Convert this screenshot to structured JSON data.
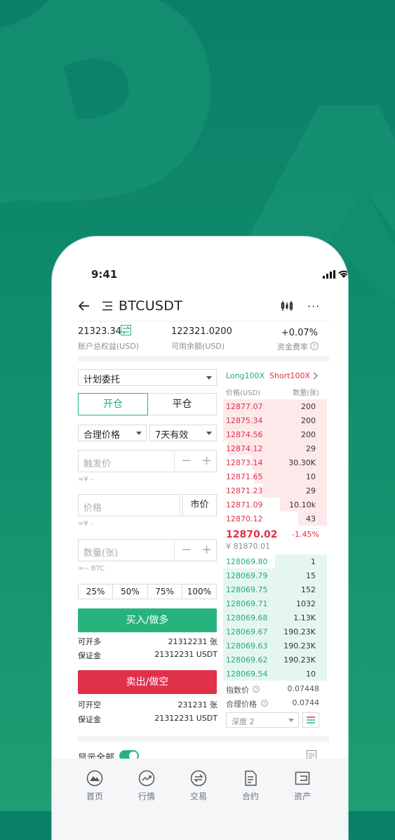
{
  "status": {
    "time": "9:41"
  },
  "header": {
    "title": "BTCUSDT"
  },
  "account": {
    "equity": "21323.34",
    "equity_label": "账户总权益(USD)",
    "available": "122321.0200",
    "available_label": "可用余额(USD)",
    "funding_rate": "+0.07%",
    "funding_label": "资金费率"
  },
  "order": {
    "type": "计划委托",
    "tabs": [
      "开仓",
      "平仓"
    ],
    "price_type": "合理价格",
    "validity": "7天有效",
    "trigger_placeholder": "触发价",
    "trigger_hint": "≈¥ -",
    "price_placeholder": "价格",
    "market_label": "市价",
    "price_hint": "≈¥ -",
    "qty_placeholder": "数量(张)",
    "qty_hint": "≈-- BTC",
    "percents": [
      "25%",
      "50%",
      "75%",
      "100%"
    ],
    "buy_label": "买入/做多",
    "can_open_long_label": "可开多",
    "can_open_long_value": "21312231 张",
    "margin_label": "保证金",
    "margin_value": "21312231 USDT",
    "sell_label": "卖出/做空",
    "can_open_short_label": "可开空",
    "can_open_short_value": "231231 张",
    "margin2_label": "保证金",
    "margin2_value": "21312231 USDT"
  },
  "orderbook": {
    "long_label": "Long100X",
    "short_label": "Short100X",
    "price_col": "价格(USD)",
    "qty_col": "数量(张)",
    "asks": [
      {
        "price": "12877.07",
        "qty": "200",
        "depth": 1.0
      },
      {
        "price": "12875.34",
        "qty": "200",
        "depth": 1.0
      },
      {
        "price": "12874.56",
        "qty": "200",
        "depth": 1.0
      },
      {
        "price": "12874.12",
        "qty": "29",
        "depth": 0.95
      },
      {
        "price": "12873.14",
        "qty": "30.30K",
        "depth": 0.72
      },
      {
        "price": "12871.65",
        "qty": "10",
        "depth": 0.7
      },
      {
        "price": "12871.23",
        "qty": "29",
        "depth": 0.62
      },
      {
        "price": "12871.09",
        "qty": "10.10k",
        "depth": 0.45
      },
      {
        "price": "12870.12",
        "qty": "43",
        "depth": 0.28
      }
    ],
    "last_price": "12870.02",
    "change": "-1.45%",
    "cny_price": "¥ 81870.01",
    "bids": [
      {
        "price": "128069.80",
        "qty": "1",
        "depth": 0.5
      },
      {
        "price": "128069.79",
        "qty": "15",
        "depth": 1.0
      },
      {
        "price": "128069.75",
        "qty": "152",
        "depth": 1.0
      },
      {
        "price": "128069.71",
        "qty": "1032",
        "depth": 1.0
      },
      {
        "price": "128069.68",
        "qty": "1.13K",
        "depth": 1.0
      },
      {
        "price": "128069.67",
        "qty": "190.23K",
        "depth": 1.0
      },
      {
        "price": "128069.63",
        "qty": "190.23K",
        "depth": 1.0
      },
      {
        "price": "128069.62",
        "qty": "190.23K",
        "depth": 1.0
      },
      {
        "price": "128069.54",
        "qty": "10",
        "depth": 1.0
      }
    ],
    "index_label": "指数价",
    "index_value": "0.07448",
    "fair_label": "合理价格",
    "fair_value": "0.0744",
    "depth_label": "深度 2"
  },
  "bottom": {
    "show_all": "显示全部"
  },
  "tabbar": [
    "首页",
    "行情",
    "交易",
    "合约",
    "资产"
  ],
  "colors": {
    "green": "#27b37e",
    "red": "#e0304a",
    "bg": "#0a8068"
  }
}
